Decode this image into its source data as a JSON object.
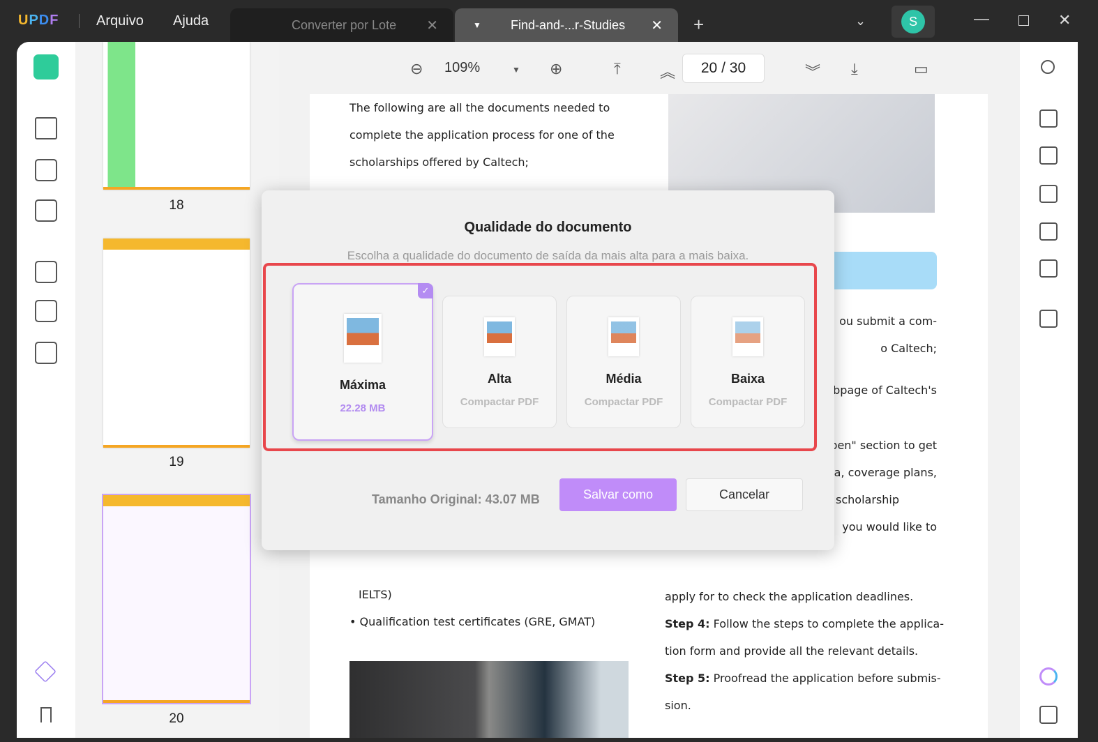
{
  "titlebar": {
    "logo": "UPDF",
    "menu": [
      "Arquivo",
      "Ajuda"
    ],
    "tabs": [
      {
        "label": "Converter por Lote",
        "active": false
      },
      {
        "label": "Find-and-...r-Studies",
        "active": true
      }
    ],
    "avatar": "S",
    "avatar_color": "#2ec4a8"
  },
  "toolbar": {
    "zoom": "109%",
    "current_page": "20",
    "separator": "/",
    "total_pages": "30"
  },
  "thumbnails": [
    {
      "page": "18"
    },
    {
      "page": "19"
    },
    {
      "page": "20",
      "selected": true
    }
  ],
  "document": {
    "left_top": [
      "The following are all the documents needed to",
      "complete the application process for one of the",
      "scholarships offered by Caltech;"
    ],
    "left_bottom": [
      "IELTS)",
      "• Qualification test certificates (GRE, GMAT)"
    ],
    "right_lines": [
      "ou submit a com-",
      "o Caltech;",
      "bpage of Caltech's",
      "pen\" section to get",
      "ia, coverage plans,",
      "scholarship",
      "you would like to",
      "apply for to check the application deadlines."
    ],
    "steps": [
      {
        "label": "Step 4:",
        "text": " Follow the steps to complete the applica-"
      },
      {
        "label": "",
        "text": "tion form and provide all the relevant details."
      },
      {
        "label": "Step 5:",
        "text": " Proofread the application before submis-"
      },
      {
        "label": "",
        "text": "sion."
      }
    ]
  },
  "dialog": {
    "title": "Qualidade do documento",
    "subtitle": "Escolha a qualidade do documento de saída da mais alta para a mais baixa.",
    "options": [
      {
        "name": "Máxima",
        "sub": "22.28 MB",
        "selected": true
      },
      {
        "name": "Alta",
        "sub": "Compactar PDF"
      },
      {
        "name": "Média",
        "sub": "Compactar PDF"
      },
      {
        "name": "Baixa",
        "sub": "Compactar PDF"
      }
    ],
    "original_size": "Tamanho Original: 43.07 MB",
    "save": "Salvar como",
    "cancel": "Cancelar",
    "accent": "#c08cf9",
    "highlight": "#e8474c"
  }
}
